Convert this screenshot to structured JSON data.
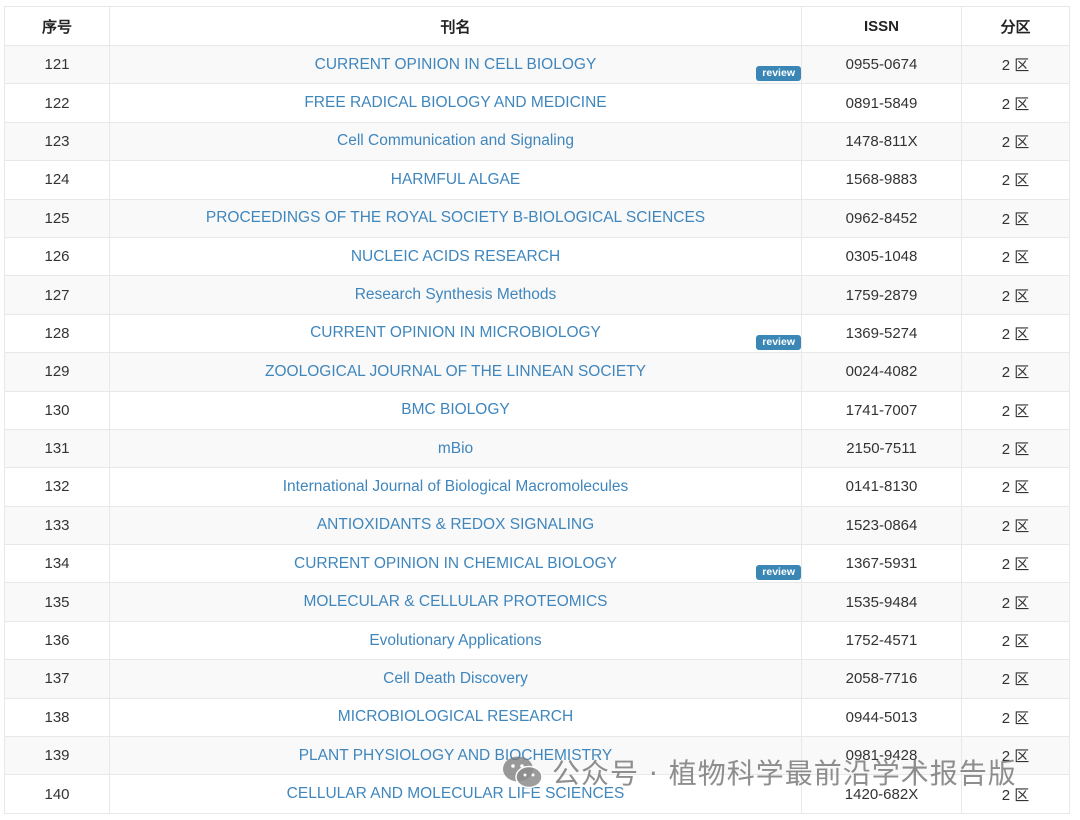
{
  "table": {
    "headers": {
      "index": "序号",
      "name": "刊名",
      "issn": "ISSN",
      "zone": "分区"
    },
    "review_label": "review",
    "rows": [
      {
        "index": "121",
        "name": "CURRENT OPINION IN CELL BIOLOGY",
        "issn": "0955-0674",
        "zone": "2 区",
        "review": true
      },
      {
        "index": "122",
        "name": "FREE RADICAL BIOLOGY AND MEDICINE",
        "issn": "0891-5849",
        "zone": "2 区",
        "review": false
      },
      {
        "index": "123",
        "name": "Cell Communication and Signaling",
        "issn": "1478-811X",
        "zone": "2 区",
        "review": false
      },
      {
        "index": "124",
        "name": "HARMFUL ALGAE",
        "issn": "1568-9883",
        "zone": "2 区",
        "review": false
      },
      {
        "index": "125",
        "name": "PROCEEDINGS OF THE ROYAL SOCIETY B-BIOLOGICAL SCIENCES",
        "issn": "0962-8452",
        "zone": "2 区",
        "review": false
      },
      {
        "index": "126",
        "name": "NUCLEIC ACIDS RESEARCH",
        "issn": "0305-1048",
        "zone": "2 区",
        "review": false
      },
      {
        "index": "127",
        "name": "Research Synthesis Methods",
        "issn": "1759-2879",
        "zone": "2 区",
        "review": false
      },
      {
        "index": "128",
        "name": "CURRENT OPINION IN MICROBIOLOGY",
        "issn": "1369-5274",
        "zone": "2 区",
        "review": true
      },
      {
        "index": "129",
        "name": "ZOOLOGICAL JOURNAL OF THE LINNEAN SOCIETY",
        "issn": "0024-4082",
        "zone": "2 区",
        "review": false
      },
      {
        "index": "130",
        "name": "BMC BIOLOGY",
        "issn": "1741-7007",
        "zone": "2 区",
        "review": false
      },
      {
        "index": "131",
        "name": "mBio",
        "issn": "2150-7511",
        "zone": "2 区",
        "review": false
      },
      {
        "index": "132",
        "name": "International Journal of Biological Macromolecules",
        "issn": "0141-8130",
        "zone": "2 区",
        "review": false
      },
      {
        "index": "133",
        "name": "ANTIOXIDANTS & REDOX SIGNALING",
        "issn": "1523-0864",
        "zone": "2 区",
        "review": false
      },
      {
        "index": "134",
        "name": "CURRENT OPINION IN CHEMICAL BIOLOGY",
        "issn": "1367-5931",
        "zone": "2 区",
        "review": true
      },
      {
        "index": "135",
        "name": "MOLECULAR & CELLULAR PROTEOMICS",
        "issn": "1535-9484",
        "zone": "2 区",
        "review": false
      },
      {
        "index": "136",
        "name": "Evolutionary Applications",
        "issn": "1752-4571",
        "zone": "2 区",
        "review": false
      },
      {
        "index": "137",
        "name": "Cell Death Discovery",
        "issn": "2058-7716",
        "zone": "2 区",
        "review": false
      },
      {
        "index": "138",
        "name": "MICROBIOLOGICAL RESEARCH",
        "issn": "0944-5013",
        "zone": "2 区",
        "review": false
      },
      {
        "index": "139",
        "name": "PLANT PHYSIOLOGY AND BIOCHEMISTRY",
        "issn": "0981-9428",
        "zone": "2 区",
        "review": false
      },
      {
        "index": "140",
        "name": "CELLULAR AND MOLECULAR LIFE SCIENCES",
        "issn": "1420-682X",
        "zone": "2 区",
        "review": false
      }
    ]
  },
  "watermark": {
    "text": "公众号 · 植物科学最前沿学术报告版",
    "icon": "wechat-icon"
  },
  "colors": {
    "link": "#3f86bd",
    "badge": "#3a87b5",
    "stripe": "#f9f9f9",
    "border": "#e8e8e8"
  }
}
